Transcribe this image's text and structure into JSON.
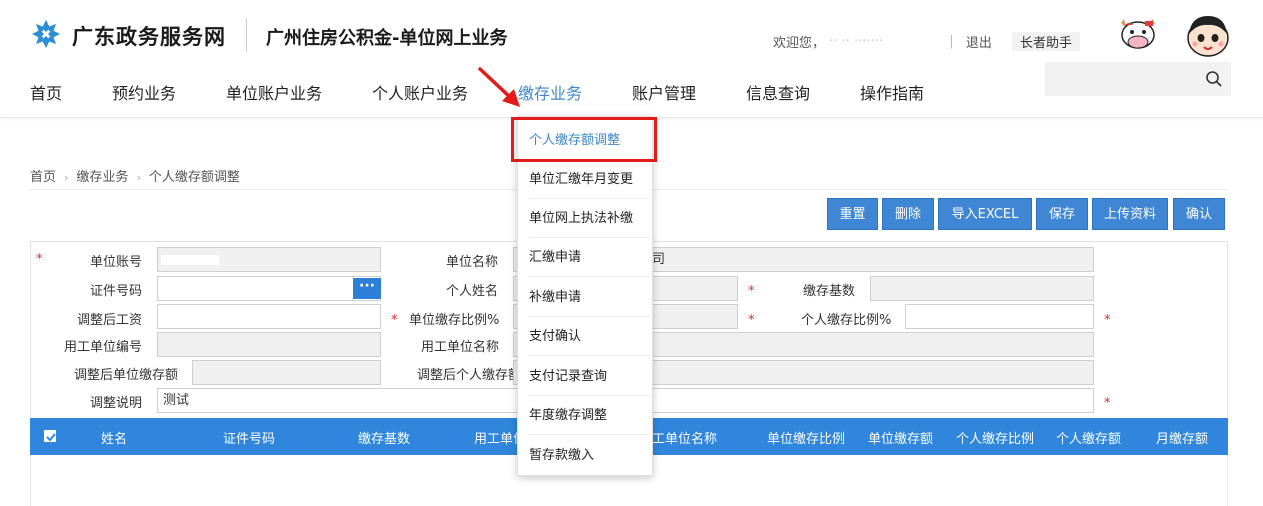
{
  "header": {
    "portal_name": "广东政务服务网",
    "service_title": "广州住房公积金-单位网上业务",
    "welcome": "欢迎您，",
    "user_masked": "·· ·· ·······",
    "logout": "退出",
    "elder_mode": "长者助手",
    "search_placeholder": ""
  },
  "nav": {
    "items": [
      {
        "label": "首页"
      },
      {
        "label": "预约业务"
      },
      {
        "label": "单位账户业务"
      },
      {
        "label": "个人账户业务"
      },
      {
        "label": "缴存业务"
      },
      {
        "label": "账户管理"
      },
      {
        "label": "信息查询"
      },
      {
        "label": "操作指南"
      }
    ],
    "active_index": 4
  },
  "breadcrumb": [
    "首页",
    "缴存业务",
    "个人缴存额调整"
  ],
  "toolbar": {
    "buttons": [
      "重置",
      "删除",
      "导入EXCEL",
      "保存",
      "上传资料",
      "确认"
    ]
  },
  "form": {
    "unit_account": {
      "label": "单位账号",
      "value": ""
    },
    "unit_name": {
      "label": "单位名称",
      "value": "司"
    },
    "id_number": {
      "label": "证件号码",
      "value": "",
      "button": "···"
    },
    "person_name": {
      "label": "个人姓名",
      "value": ""
    },
    "deposit_base": {
      "label": "缴存基数",
      "value": ""
    },
    "adjusted_salary": {
      "label": "调整后工资",
      "value": ""
    },
    "unit_ratio": {
      "label": "单位缴存比例%",
      "value": ""
    },
    "person_ratio": {
      "label": "个人缴存比例%",
      "value": ""
    },
    "employer_code": {
      "label": "用工单位编号",
      "value": ""
    },
    "employer_name": {
      "label": "用工单位名称",
      "value": ""
    },
    "adjusted_unit_amount": {
      "label": "调整后单位缴存额",
      "value": ""
    },
    "adjusted_person_amount": {
      "label": "调整后个人缴存额",
      "value": ""
    },
    "adjust_note": {
      "label": "调整说明",
      "value": "测试"
    },
    "required_mark": "*"
  },
  "table": {
    "columns": [
      "姓名",
      "证件号码",
      "缴存基数",
      "用工单位",
      "工单位名称",
      "单位缴存比例",
      "单位缴存额",
      "个人缴存比例",
      "个人缴存额",
      "月缴存额"
    ],
    "check_glyph": "✓"
  },
  "dropdown": {
    "items": [
      {
        "label": "个人缴存额调整"
      },
      {
        "label": "单位汇缴年月变更"
      },
      {
        "label": "单位网上执法补缴"
      },
      {
        "label": "汇缴申请"
      },
      {
        "label": "补缴申请"
      },
      {
        "label": "支付确认"
      },
      {
        "label": "支付记录查询"
      },
      {
        "label": "年度缴存调整"
      },
      {
        "label": "暂存款缴入"
      }
    ],
    "highlight_index": 0
  },
  "colors": {
    "primary": "#2f86dc",
    "active_nav": "#3f87c9",
    "highlight_frame": "#e31b1b",
    "required": "#e12b2b"
  }
}
